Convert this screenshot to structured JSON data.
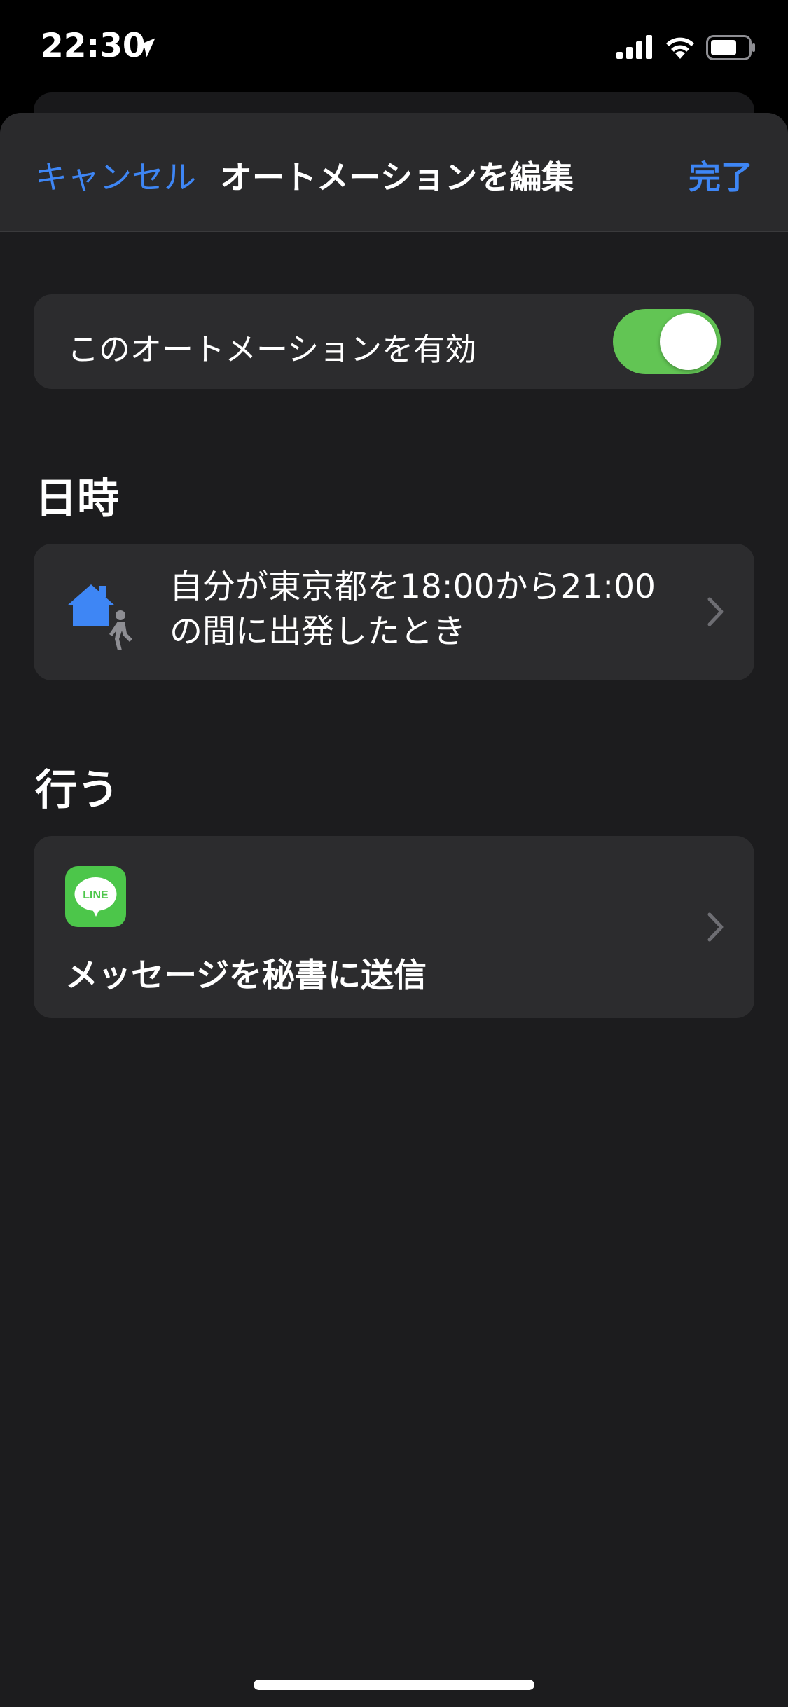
{
  "status_bar": {
    "time": "22:30",
    "icons": [
      "location-arrow-icon",
      "cellular-signal-icon",
      "wifi-icon",
      "battery-icon"
    ]
  },
  "nav": {
    "cancel_label": "キャンセル",
    "title": "オートメーションを編集",
    "done_label": "完了"
  },
  "toggle": {
    "label": "このオートメーションを有効",
    "enabled": true
  },
  "sections": {
    "when_header": "日時",
    "do_header": "行う"
  },
  "trigger": {
    "icon": "home-leave-icon",
    "line1": "自分が東京都を18:00から21:00",
    "line2": "の間に出発したとき"
  },
  "action": {
    "app_icon": "line-app-icon",
    "app_icon_text": "LINE",
    "label": "メッセージを秘書に送信"
  },
  "colors": {
    "accent_blue": "#3e86f5",
    "toggle_green": "#62c554",
    "line_green": "#4cc64a",
    "background": "#1c1c1e",
    "card": "#2c2c2e"
  }
}
